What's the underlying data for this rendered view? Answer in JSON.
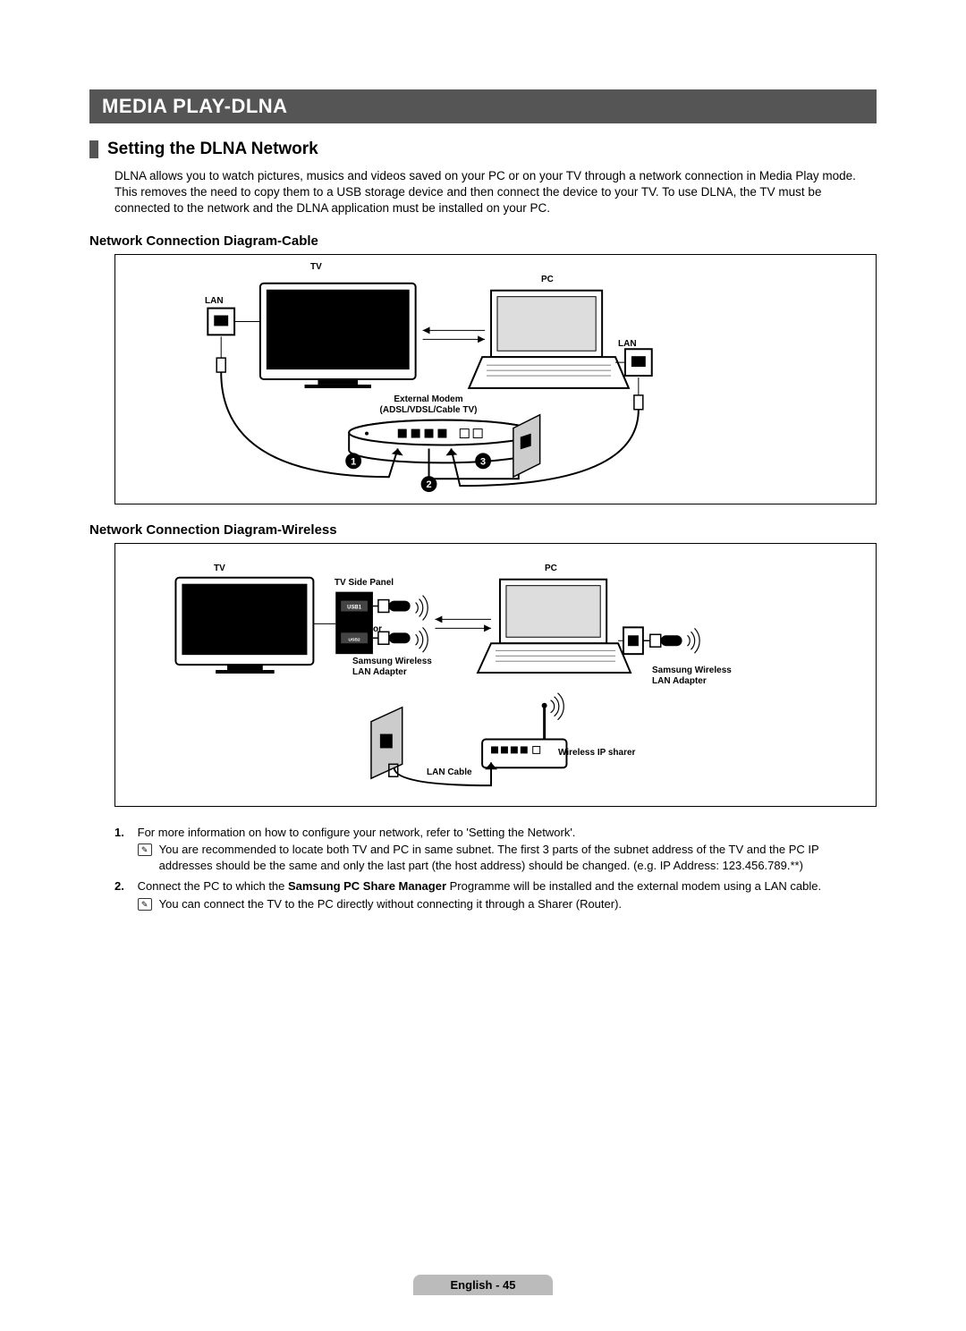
{
  "chapter": "MEDIA PLAY-DLNA",
  "section_title": "Setting the DLNA Network",
  "intro": "DLNA allows you to watch pictures, musics and videos saved on your PC or on your TV through a network connection in Media Play mode. This removes the need to copy them to a USB storage device and then connect the device to your TV. To use DLNA, the TV must be connected to the network and the DLNA application must be installed on your PC.",
  "subheading_cable": "Network Connection Diagram-Cable",
  "subheading_wireless": "Network Connection Diagram-Wireless",
  "labels": {
    "tv": "TV",
    "pc": "PC",
    "lan": "LAN",
    "external_modem_l1": "External Modem",
    "external_modem_l2": "(ADSL/VDSL/Cable TV)",
    "tv_side_panel": "TV Side Panel",
    "or": "or",
    "samsung_wireless_l1": "Samsung Wireless",
    "samsung_wireless_l2": "LAN Adapter",
    "wireless_ip_sharer": "Wireless IP sharer",
    "lan_cable": "LAN Cable",
    "usb1": "USB1",
    "usb2": "USB2(HDD)"
  },
  "notes": {
    "n1_lead": "For more information on how to configure your network, refer to 'Setting the Network'.",
    "n1_sub": "You are recommended to locate both TV and PC in same subnet. The first 3 parts of the subnet address of the TV and the PC IP addresses should be the same and only the last part (the host address) should be changed. (e.g. IP Address: 123.456.789.**)",
    "n2_pre": "Connect the PC to which the ",
    "n2_bold": "Samsung PC Share Manager",
    "n2_post": " Programme will be installed and the external modem using a LAN cable.",
    "n2_sub": "You can connect the TV to the PC directly without connecting it through a Sharer (Router)."
  },
  "footer": "English - 45"
}
